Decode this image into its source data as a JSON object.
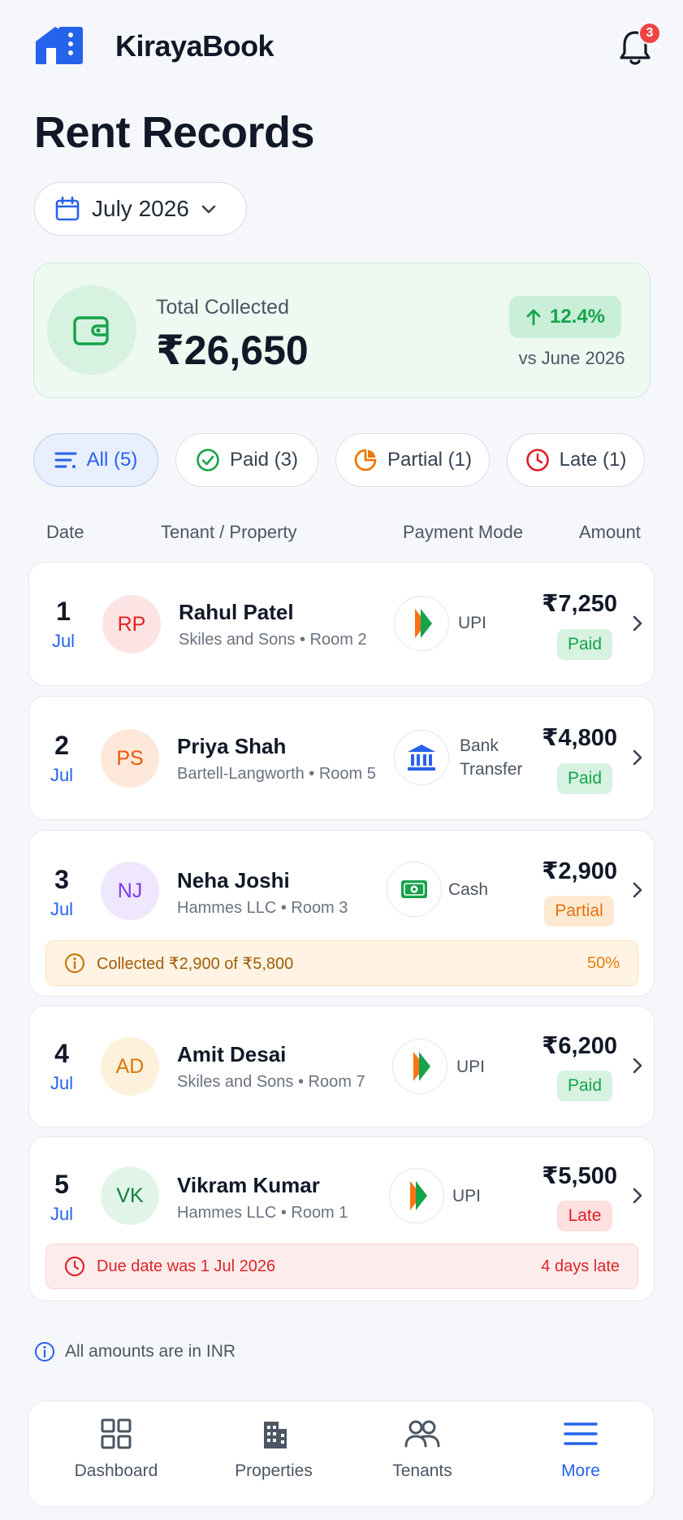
{
  "app": {
    "name": "KirayaBook",
    "notification_count": "3"
  },
  "page": {
    "title": "Rent Records"
  },
  "month_selector": {
    "label": "July 2026"
  },
  "summary": {
    "label": "Total Collected",
    "value": "₹26,650",
    "change": "12.4%",
    "comparison": "vs June 2026"
  },
  "filters": [
    {
      "label": "All (5)",
      "icon": "list-filter-icon",
      "active": true
    },
    {
      "label": "Paid (3)",
      "icon": "check-circle-icon"
    },
    {
      "label": "Partial (1)",
      "icon": "partial-pie-icon"
    },
    {
      "label": "Late (1)",
      "icon": "clock-icon"
    }
  ],
  "columns": [
    "Date",
    "Tenant / Property",
    "Payment Mode",
    "Amount"
  ],
  "records": [
    {
      "day": "1",
      "month": "Jul",
      "initials": "RP",
      "name": "Rahul Patel",
      "property": "Skiles and Sons • Room 2",
      "mode": "UPI",
      "amount": "₹7,250",
      "status": "Paid"
    },
    {
      "day": "2",
      "month": "Jul",
      "initials": "PS",
      "name": "Priya Shah",
      "property": "Bartell-Langworth • Room 5",
      "mode_line1": "Bank",
      "mode_line2": "Transfer",
      "amount": "₹4,800",
      "status": "Paid"
    },
    {
      "day": "3",
      "month": "Jul",
      "initials": "NJ",
      "name": "Neha Joshi",
      "property": "Hammes LLC • Room 3",
      "mode": "Cash",
      "amount": "₹2,900",
      "status": "Partial",
      "note": "Collected ₹2,900 of ₹5,800",
      "note_right": "50%"
    },
    {
      "day": "4",
      "month": "Jul",
      "initials": "AD",
      "name": "Amit Desai",
      "property": "Skiles and Sons  • Room 7",
      "mode": "UPI",
      "amount": "₹6,200",
      "status": "Paid"
    },
    {
      "day": "5",
      "month": "Jul",
      "initials": "VK",
      "name": "Vikram Kumar",
      "property": "Hammes LLC • Room 1",
      "mode": "UPI",
      "amount": "₹5,500",
      "status": "Late",
      "note": "Due date was 1 Jul 2026",
      "note_right": "4 days late"
    }
  ],
  "footnote": "All amounts are in INR",
  "nav": [
    {
      "label": "Dashboard",
      "icon": "dashboard-icon"
    },
    {
      "label": "Properties",
      "icon": "building-icon"
    },
    {
      "label": "Tenants",
      "icon": "users-icon"
    },
    {
      "label": "More",
      "icon": "menu-icon",
      "active": true
    }
  ],
  "colors": {
    "accent": "#2563eb",
    "paid": "#15a34a",
    "partial": "#e8700e",
    "late": "#e11d2a"
  }
}
